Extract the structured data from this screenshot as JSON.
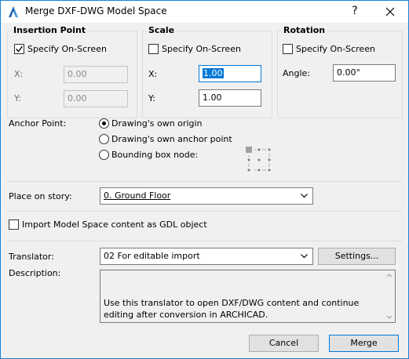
{
  "window": {
    "title": "Merge DXF-DWG Model Space",
    "help_glyph": "?",
    "close_glyph": "✕"
  },
  "insertion_point": {
    "title": "Insertion Point",
    "specify_label": "Specify On-Screen",
    "specify_checked": true,
    "x_label": "X:",
    "x_value": "0.00",
    "y_label": "Y:",
    "y_value": "0.00"
  },
  "scale": {
    "title": "Scale",
    "specify_label": "Specify On-Screen",
    "specify_checked": false,
    "x_label": "X:",
    "x_value": "1.00",
    "y_label": "Y:",
    "y_value": "1.00"
  },
  "rotation": {
    "title": "Rotation",
    "specify_label": "Specify On-Screen",
    "specify_checked": false,
    "angle_label": "Angle:",
    "angle_value": "0.00°"
  },
  "anchor_point": {
    "label": "Anchor Point:",
    "options": [
      "Drawing's own origin",
      "Drawing's own anchor point",
      "Bounding box node:"
    ],
    "selected_index": 0
  },
  "place_on_story": {
    "label": "Place on story:",
    "value": "0. Ground Floor"
  },
  "import_gdl": {
    "label": "Import Model Space content as GDL object",
    "checked": false
  },
  "translator": {
    "label": "Translator:",
    "value": "02 For editable import",
    "settings_label": "Settings..."
  },
  "description": {
    "label": "Description:",
    "text": "Use this translator to open DXF/DWG content and continue editing after conversion in ARCHICAD."
  },
  "footer": {
    "cancel_label": "Cancel",
    "merge_label": "Merge"
  },
  "colors": {
    "accent": "#0078d7",
    "window_border": "#1883d7",
    "background": "#f0f0f0"
  }
}
